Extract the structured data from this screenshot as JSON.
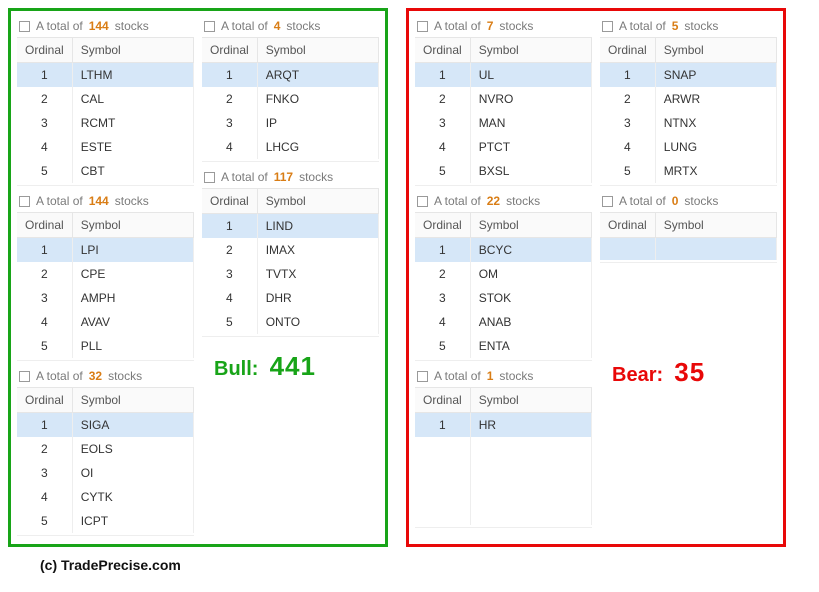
{
  "labels": {
    "ordinal": "Ordinal",
    "symbol": "Symbol",
    "total_prefix": "A total of ",
    "total_suffix_trunc": " stocks",
    "total_suffix_short": " stock",
    "bull_label": "Bull:",
    "bear_label": "Bear:",
    "credit": "(c) TradePrecise.com"
  },
  "bull": {
    "total": "441",
    "count_color": "#d97d15",
    "blocks_colA": [
      {
        "count": "144",
        "rows": [
          [
            1,
            "LTHM"
          ],
          [
            2,
            "CAL"
          ],
          [
            3,
            "RCMT"
          ],
          [
            4,
            "ESTE"
          ],
          [
            5,
            "CBT"
          ]
        ]
      },
      {
        "count": "144",
        "rows": [
          [
            1,
            "LPI"
          ],
          [
            2,
            "CPE"
          ],
          [
            3,
            "AMPH"
          ],
          [
            4,
            "AVAV"
          ],
          [
            5,
            "PLL"
          ]
        ]
      },
      {
        "count": "32",
        "rows": [
          [
            1,
            "SIGA"
          ],
          [
            2,
            "EOLS"
          ],
          [
            3,
            "OI"
          ],
          [
            4,
            "CYTK"
          ],
          [
            5,
            "ICPT"
          ]
        ]
      }
    ],
    "blocks_colB": [
      {
        "count": "4",
        "rows": [
          [
            1,
            "ARQT"
          ],
          [
            2,
            "FNKO"
          ],
          [
            3,
            "IP"
          ],
          [
            4,
            "LHCG"
          ]
        ]
      },
      {
        "count": "117",
        "rows": [
          [
            1,
            "LIND"
          ],
          [
            2,
            "IMAX"
          ],
          [
            3,
            "TVTX"
          ],
          [
            4,
            "DHR"
          ],
          [
            5,
            "ONTO"
          ]
        ]
      }
    ]
  },
  "bear": {
    "total": "35",
    "count_color": "#d97d15",
    "blocks_colA": [
      {
        "count": "7",
        "rows": [
          [
            1,
            "UL"
          ],
          [
            2,
            "NVRO"
          ],
          [
            3,
            "MAN"
          ],
          [
            4,
            "PTCT"
          ],
          [
            5,
            "BXSL"
          ]
        ]
      },
      {
        "count": "22",
        "rows": [
          [
            1,
            "BCYC"
          ],
          [
            2,
            "OM"
          ],
          [
            3,
            "STOK"
          ],
          [
            4,
            "ANAB"
          ],
          [
            5,
            "ENTA"
          ]
        ]
      },
      {
        "count": "1",
        "rows": [
          [
            1,
            "HR"
          ]
        ],
        "pad": 4
      }
    ],
    "blocks_colB": [
      {
        "count": "5",
        "rows": [
          [
            1,
            "SNAP"
          ],
          [
            2,
            "ARWR"
          ],
          [
            3,
            "NTNX"
          ],
          [
            4,
            "LUNG"
          ],
          [
            5,
            "MRTX"
          ]
        ]
      },
      {
        "count": "0",
        "rows": [],
        "pad": 1
      }
    ]
  }
}
